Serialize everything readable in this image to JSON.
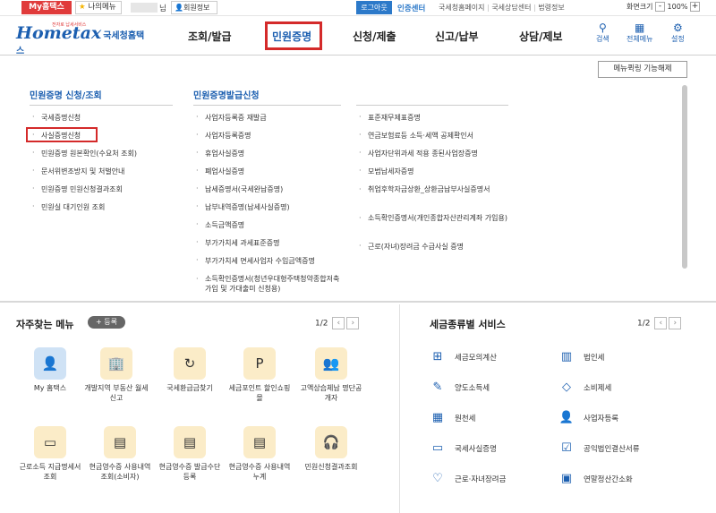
{
  "topbar": {
    "myhome": "My홈택스",
    "mymenu": "나의메뉴",
    "username_suffix": "님",
    "member_info": "회원정보",
    "logout": "로그아웃",
    "cert_center": "인증센터",
    "links": [
      "국세청홈페이지",
      "국세상담센터",
      "법령정보"
    ],
    "zoom_label": "화면크기",
    "zoom_value": "100%"
  },
  "header": {
    "logo_main": "Hometax",
    "logo_kr": "국세청홈택스",
    "logo_slogan": "전자로 납세서비스",
    "gnb": [
      "조회/발급",
      "민원증명",
      "신청/제출",
      "신고/납부",
      "상담/제보"
    ],
    "util": [
      "검색",
      "전체메뉴",
      "설정"
    ]
  },
  "panel": {
    "quicklink": "메뉴퀵링 기능해제",
    "col1_title": "민원증명 신청/조회",
    "col2_title": "민원증명발급신청",
    "col1": [
      "국세증명신청",
      "사실증명신청",
      "민원증명 원본확인(수요처 조회)",
      "문서위변조방지 및 처벌안내",
      "민원증명 민원신청결과조회",
      "민원실 대기인원 조회"
    ],
    "col2": [
      "사업자등록증 재발급",
      "사업자등록증명",
      "휴업사실증명",
      "폐업사실증명",
      "납세증명서(국세완납증명)",
      "납부내역증명(납세사실증명)",
      "소득금액증명",
      "부가가치세 과세표준증명",
      "부가가치세 면세사업자 수입금액증명",
      "소득확인증명서(청년우대형주택청약종합저축 가입 및 가대출미 신청용)"
    ],
    "col3": [
      "표준재무제표증명",
      "연금보험료등 소득·세액 공제확인서",
      "사업자단위과세 적용 종된사업장증명",
      "모범납세자증명",
      "취업후학자금상환_상환금납부사실증명서",
      "소득확인증명서(개인종합자산관리계좌 가입용)",
      "근로(자녀)장려금 수급사실 증명"
    ]
  },
  "favorites": {
    "title": "자주찾는 메뉴",
    "register": "등록",
    "page": "1/2",
    "items": [
      "My 홈택스",
      "개발지역 부동산 월세신고",
      "국세환급금찾기",
      "세금포인트 할인쇼핑몰",
      "고액상습체납 명단공개자",
      "근로소득 지급명세서 조회",
      "현금영수증 사용내역조회(소비자)",
      "현금영수증 발급수단 등록",
      "현금영수증 사용내역 누계",
      "민원신청결과조회"
    ]
  },
  "services": {
    "title": "세금종류별 서비스",
    "page": "1/2",
    "items": [
      "세금모의계산",
      "법인세",
      "양도소득세",
      "소비제세",
      "원천세",
      "사업자등록",
      "국세사실증명",
      "공익법인결산서류",
      "근로·자녀장려금",
      "연말정산간소화"
    ]
  }
}
